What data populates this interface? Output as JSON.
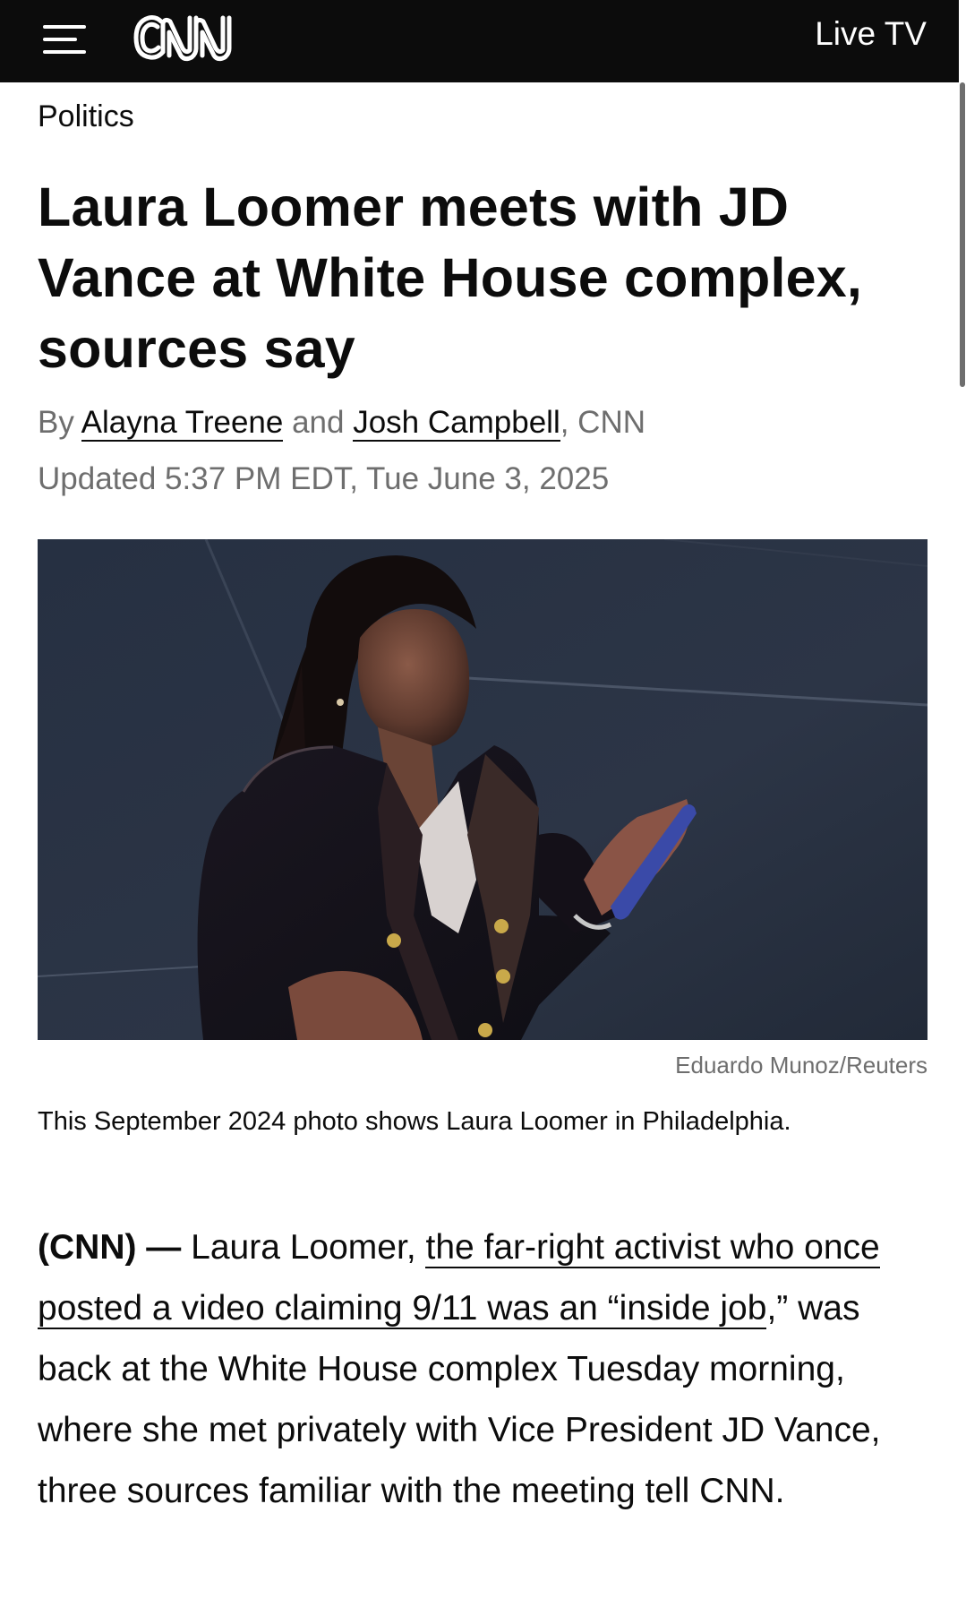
{
  "header": {
    "menu_icon": "hamburger-menu-icon",
    "logo_text": "CNN",
    "live_tv_label": "Live TV",
    "background_color": "#0c0c0c"
  },
  "article": {
    "section": "Politics",
    "headline": "Laura Loomer meets with JD Vance at White House complex, sources say",
    "byline": {
      "prefix": "By ",
      "author1": "Alayna Treene",
      "joiner": " and ",
      "author2": "Josh Campbell",
      "suffix": ", CNN"
    },
    "updated": "Updated 5:37 PM EDT, Tue June 3, 2025",
    "image": {
      "credit": "Eduardo Munoz/Reuters",
      "caption": "This September 2024 photo shows Laura Loomer in Philadelphia."
    },
    "body": {
      "dateline": "(CNN) —",
      "text_before_link": " Laura Loomer, ",
      "link_text": "the far-right activist who once posted a video claiming 9/11 was an “inside job",
      "text_after_link": ",” was back at the White House complex Tuesday morning, where she met privately with Vice President JD Vance, three sources familiar with the meeting tell CNN."
    }
  },
  "colors": {
    "text_primary": "#0c0c0c",
    "text_secondary": "#6e6e6e",
    "background": "#ffffff"
  }
}
